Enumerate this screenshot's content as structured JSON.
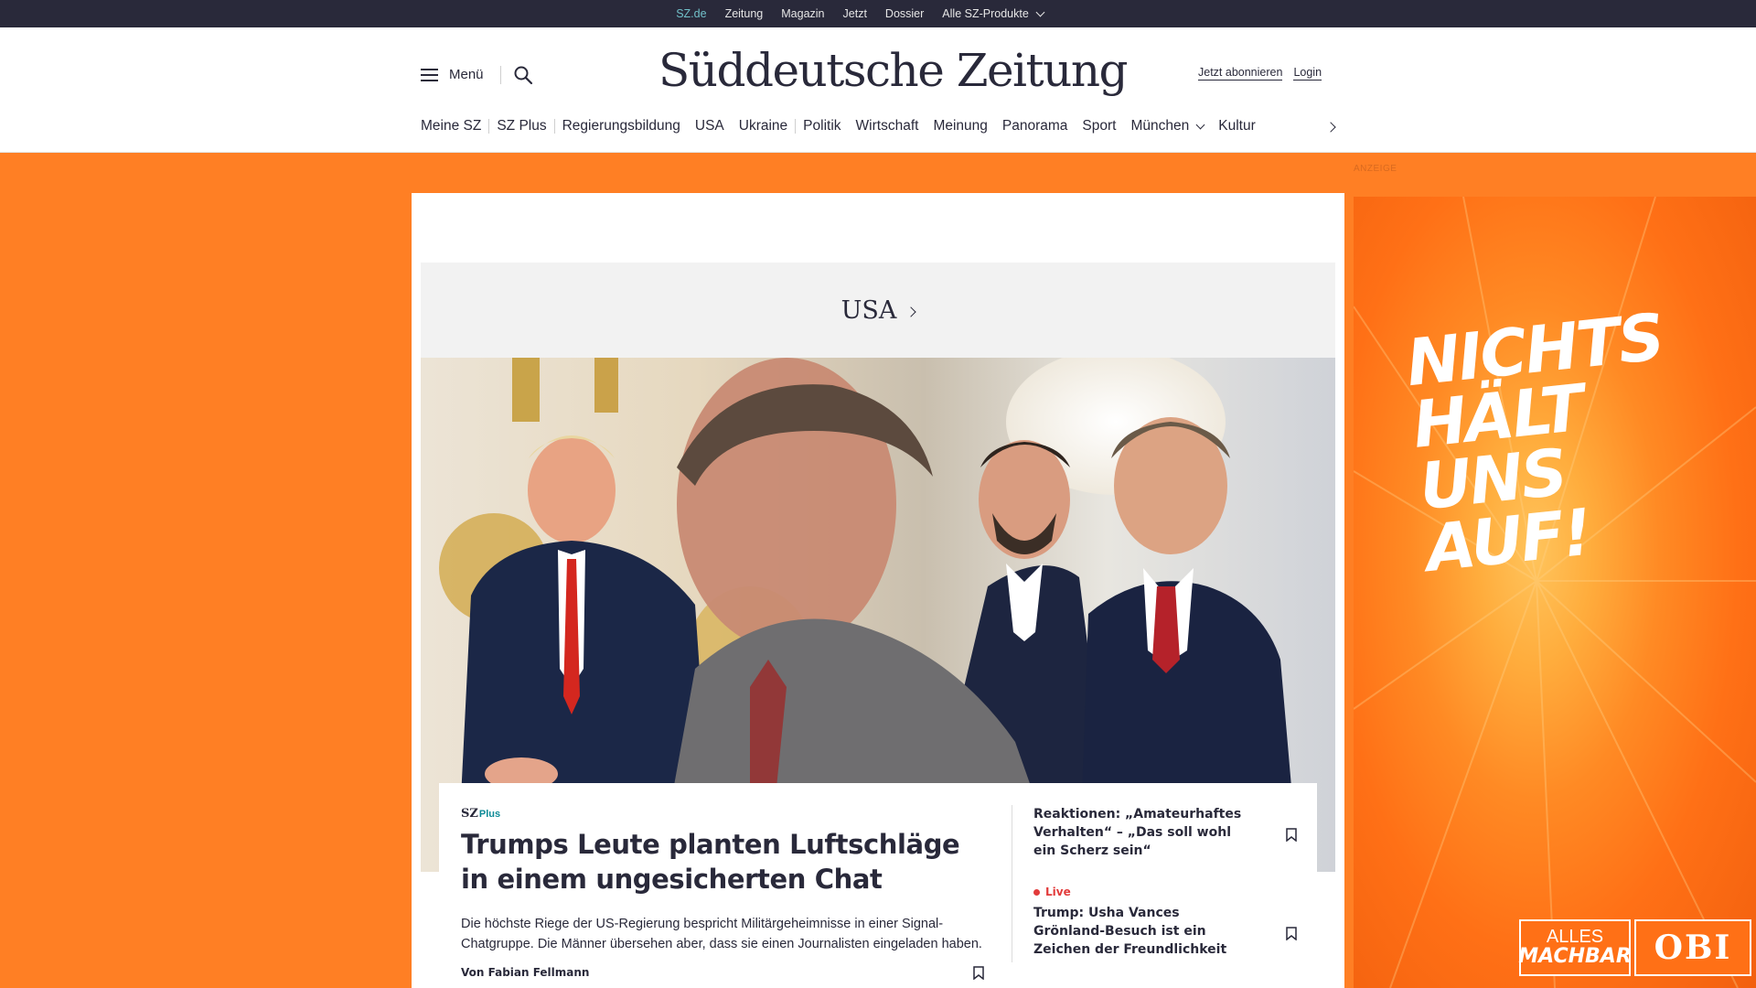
{
  "topbar": {
    "items": [
      "SZ.de",
      "Zeitung",
      "Magazin",
      "Jetzt",
      "Dossier",
      "Alle SZ-Produkte"
    ],
    "active": "SZ.de"
  },
  "header": {
    "menu_label": "Menü",
    "logo_text": "Süddeutsche Zeitung",
    "subscribe_label": "Jetzt abonnieren",
    "login_label": "Login"
  },
  "nav": {
    "items": [
      "Meine SZ",
      "SZ Plus",
      "Regierungsbildung",
      "USA",
      "Ukraine",
      "Politik",
      "Wirtschaft",
      "Meinung",
      "Panorama",
      "Sport",
      "München",
      "Kultur"
    ]
  },
  "ad": {
    "label": "ANZEIGE",
    "slogan_line1": "NICHTS HÄLT",
    "slogan_line2": "UNS AUF!",
    "brand_tag1": "ALLES",
    "brand_tag2": "MACHBAR",
    "brand": "OBI"
  },
  "section": {
    "title": "USA"
  },
  "teaser": {
    "badge_sz": "SZ",
    "badge_plus": "Plus",
    "title": "Trumps Leute planten Luftschläge in einem ungesicherten Chat",
    "text": "Die höchste Riege der US-Regierung bespricht Militärgeheimnisse in einer Signal-Chatgruppe. Die Männer übersehen aber, dass sie einen Journalisten eingeladen haben.",
    "author": "Von Fabian Fellmann"
  },
  "side": {
    "item1": "Reaktionen: „Amateurhaftes Verhalten“ – „Das soll wohl ein Scherz sein“",
    "live_label": "Live",
    "item2": "Trump: Usha Vances Grönland-Besuch ist ein Zeichen der Freundlichkeit"
  },
  "colors": {
    "page_bg": "#ff7f24",
    "topbar_bg": "#29293a",
    "text": "#29293a",
    "plus_teal": "#0d8a96",
    "live_red": "#e23b3b",
    "active_topbar": "#71c0c9"
  },
  "icons": [
    "hamburger-icon",
    "search-icon",
    "chevron-down-icon",
    "chevron-right-icon",
    "bookmark-icon"
  ]
}
